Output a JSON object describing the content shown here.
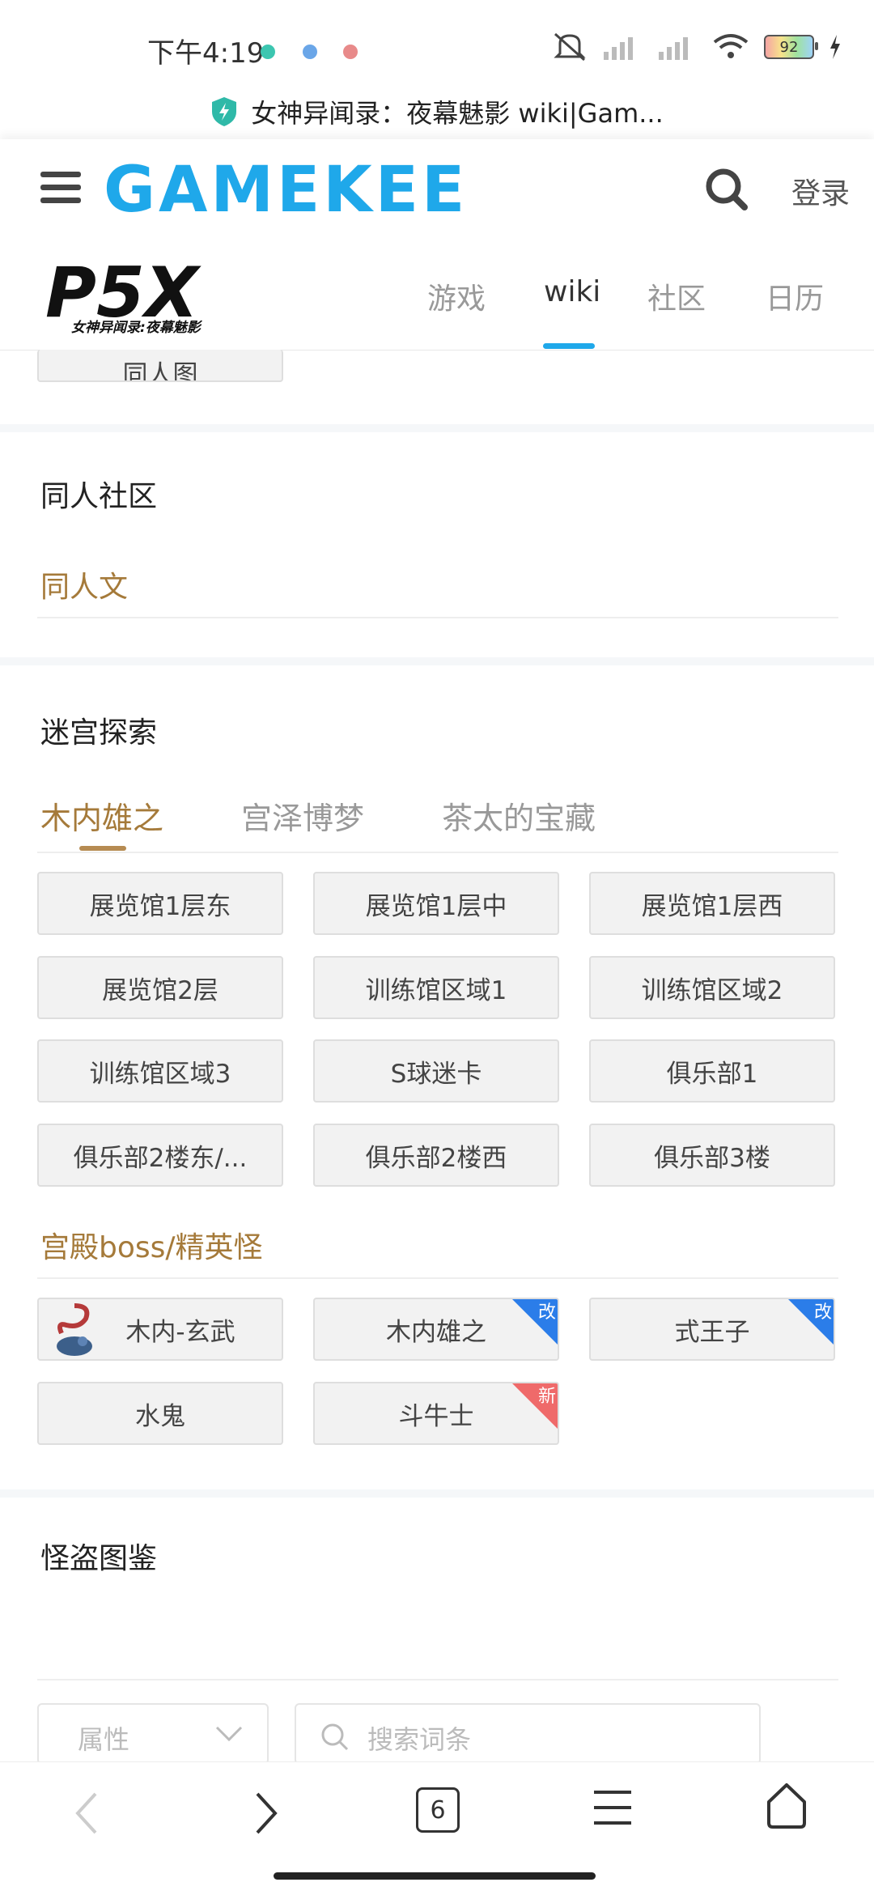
{
  "status_bar": {
    "time": "下午4:19",
    "battery": "92"
  },
  "url_bar": {
    "title": "女神异闻录：夜幕魅影 wiki|Gam..."
  },
  "site_header": {
    "logo": "GAMEKEE",
    "login": "登录"
  },
  "game_nav": {
    "logo_main": "P5X",
    "logo_sub": "女神异闻录:夜幕魅影",
    "tabs": [
      "游戏",
      "wiki",
      "社区",
      "日历"
    ]
  },
  "partial_button": "同人图",
  "fan_section": {
    "title": "同人社区",
    "link": "同人文"
  },
  "dungeon_section": {
    "title": "迷宫探索",
    "tabs": [
      "木内雄之",
      "宫泽博梦",
      "茶太的宝藏"
    ],
    "areas": [
      "展览馆1层东",
      "展览馆1层中",
      "展览馆1层西",
      "展览馆2层",
      "训练馆区域1",
      "训练馆区域2",
      "训练馆区域3",
      "S球迷卡",
      "俱乐部1",
      "俱乐部2楼东/...",
      "俱乐部2楼西",
      "俱乐部3楼"
    ],
    "boss_title": "宫殿boss/精英怪",
    "bosses": [
      {
        "name": "木内-玄武",
        "badge": ""
      },
      {
        "name": "木内雄之",
        "badge": "改"
      },
      {
        "name": "式王子",
        "badge": "改"
      },
      {
        "name": "水鬼",
        "badge": ""
      },
      {
        "name": "斗牛士",
        "badge": "新"
      }
    ]
  },
  "monster_section": {
    "title": "怪盗图鉴",
    "filter_placeholder": "属性",
    "search_placeholder": "搜索词条"
  },
  "browser_bar": {
    "tab_count": "6"
  }
}
